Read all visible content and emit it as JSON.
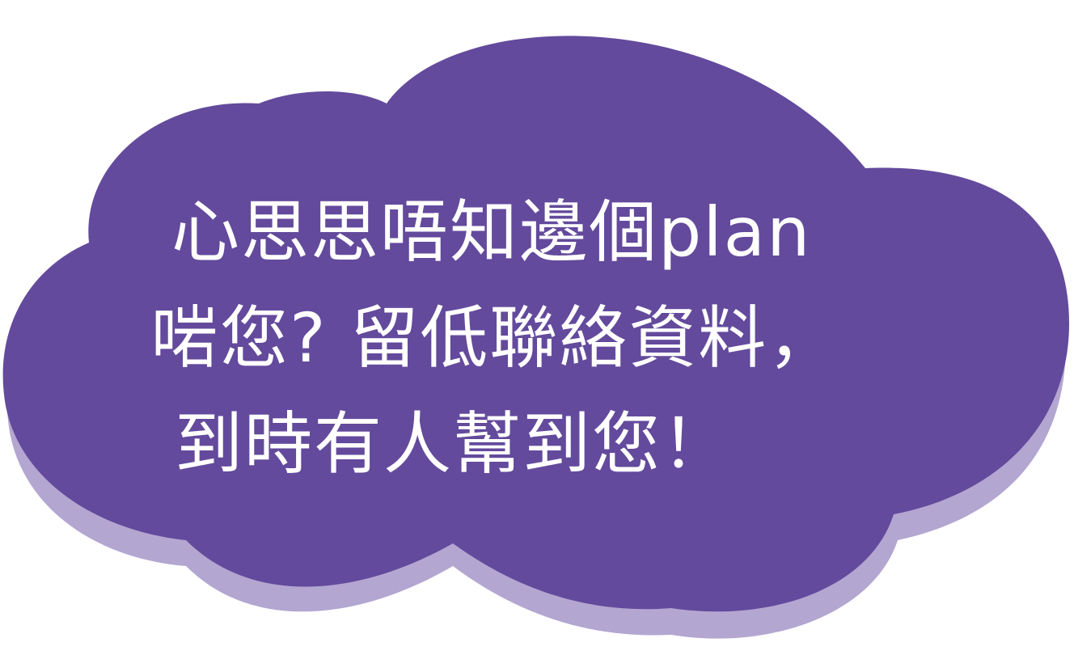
{
  "colors": {
    "cloud_fill": "#634a9c",
    "cloud_shadow": "#b3a6d1",
    "text": "#ffffff",
    "background": "#ffffff"
  },
  "message": {
    "line1": "心思思唔知邊個plan",
    "line2": "啱您? 留低聯絡資料，",
    "line3": "到時有人幫到您！"
  }
}
